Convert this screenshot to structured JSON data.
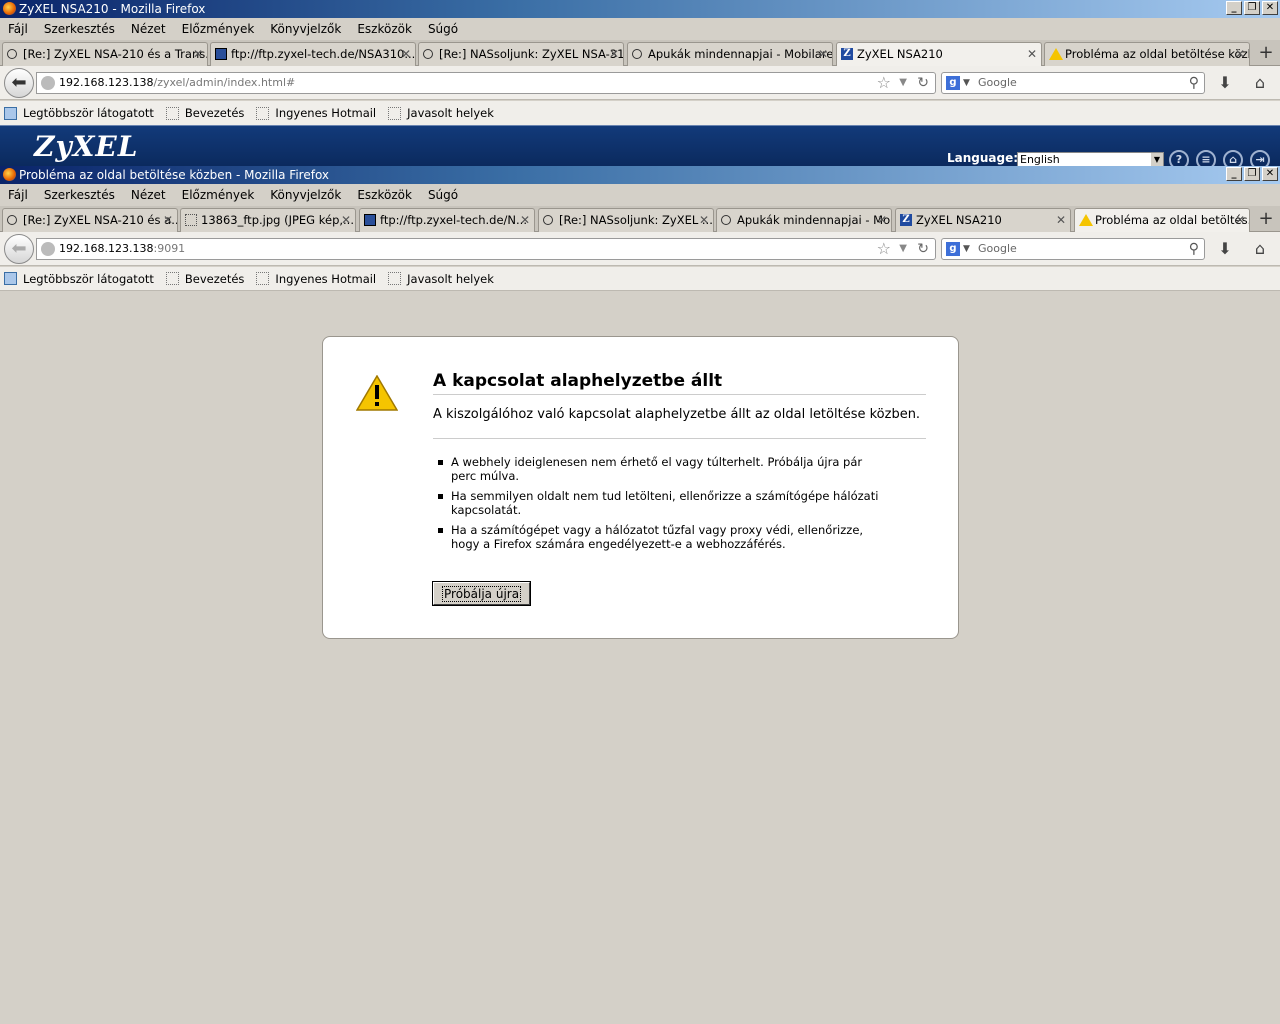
{
  "back_window": {
    "title": "ZyXEL NSA210 - Mozilla Firefox",
    "menu": [
      "Fájl",
      "Szerkesztés",
      "Nézet",
      "Előzmények",
      "Könyvjelzők",
      "Eszközök",
      "Súgó"
    ],
    "tabs": [
      {
        "label": "[Re:] ZyXEL NSA-210 és a Trans...",
        "icon": "bubble-icon"
      },
      {
        "label": "ftp://ftp.zyxel-tech.de/NSA310...",
        "icon": "ftp-icon"
      },
      {
        "label": "[Re:] NASsoljunk: ZyXEL NSA-31...",
        "icon": "bubble-icon"
      },
      {
        "label": "Apukák mindennapjai - Mobilare...",
        "icon": "bubble-icon"
      },
      {
        "label": "ZyXEL NSA210",
        "icon": "zyxel-icon",
        "active": true
      },
      {
        "label": "Probléma az oldal betöltése közb...",
        "icon": "warning-icon"
      }
    ],
    "url_host": "192.168.123.138",
    "url_path": "/zyxel/admin/index.html#",
    "search_placeholder": "Google",
    "bookmarks": [
      "Legtöbbször látogatott",
      "Bevezetés",
      "Ingyenes Hotmail",
      "Javasolt helyek"
    ],
    "zyxel": {
      "logo": "ZyXEL",
      "language_label": "Language:",
      "language_value": "English"
    }
  },
  "front_window": {
    "title": "Probléma az oldal betöltése közben - Mozilla Firefox",
    "menu": [
      "Fájl",
      "Szerkesztés",
      "Nézet",
      "Előzmények",
      "Könyvjelzők",
      "Eszközök",
      "Súgó"
    ],
    "tabs": [
      {
        "label": "[Re:] ZyXEL NSA-210 és a...",
        "icon": "bubble-icon"
      },
      {
        "label": "13863_ftp.jpg (JPEG kép,...",
        "icon": "image-icon"
      },
      {
        "label": "ftp://ftp.zyxel-tech.de/N...",
        "icon": "ftp-icon"
      },
      {
        "label": "[Re:] NASsoljunk: ZyXEL ...",
        "icon": "bubble-icon"
      },
      {
        "label": "Apukák mindennapjai - Mo...",
        "icon": "bubble-icon"
      },
      {
        "label": "ZyXEL NSA210",
        "icon": "zyxel-icon"
      },
      {
        "label": "Probléma az oldal betöltés...",
        "icon": "warning-icon",
        "active": true
      }
    ],
    "url_host": "192.168.123.138",
    "url_path": ":9091",
    "search_placeholder": "Google",
    "bookmarks": [
      "Legtöbbször látogatott",
      "Bevezetés",
      "Ingyenes Hotmail",
      "Javasolt helyek"
    ]
  },
  "error": {
    "title": "A kapcsolat alaphelyzetbe állt",
    "short_desc": "A kiszolgálóhoz való kapcsolat alaphelyzetbe állt az oldal letöltése közben.",
    "items": [
      "A webhely ideiglenesen nem érhető el vagy túlterhelt. Próbálja újra pár perc múlva.",
      "Ha semmilyen oldalt nem tud letölteni, ellenőrizze a számítógépe hálózati kapcsolatát.",
      "Ha a számítógépet vagy a hálózatot tűzfal vagy proxy védi, ellenőrizze, hogy a Firefox számára engedélyezett-e a webhozzáférés."
    ],
    "retry_label": "Próbálja újra"
  },
  "colors": {
    "titlebar": "#0a246a",
    "zyxel_banner": "#0b2a5e",
    "warning_yellow": "#f5c400"
  }
}
